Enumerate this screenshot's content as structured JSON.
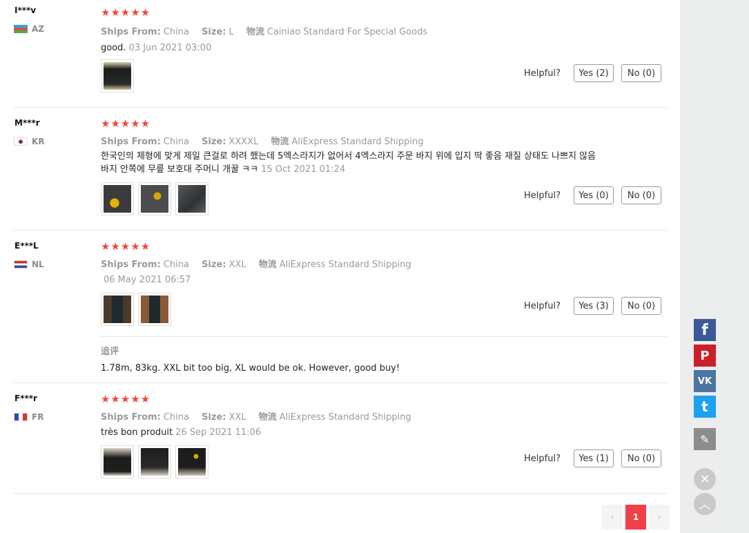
{
  "reviews": [
    {
      "user": "I***v",
      "country": "AZ",
      "stars": "★★★★★",
      "ships_label": "Ships From:",
      "ships_value": "China",
      "size_label": "Size:",
      "size_value": "L",
      "shipping_label": "物流",
      "shipping_value": "Cainiao Standard For Special Goods",
      "text": "good.",
      "date": "03 Jun 2021 03:00",
      "helpful_label": "Helpful?",
      "yes": "Yes (2)",
      "no": "No (0)"
    },
    {
      "user": "M***r",
      "country": "KR",
      "stars": "★★★★★",
      "ships_label": "Ships From:",
      "ships_value": "China",
      "size_label": "Size:",
      "size_value": "XXXXL",
      "shipping_label": "物流",
      "shipping_value": "AliExpress Standard Shipping",
      "text": "한국인의 체형에 맞게 제일 큰걸로 하려 했는데 5엑스라지가 없어서 4엑스라지 주문 바지 위에 입지 딱 좋음 재질 상태도 나쁘지 않음 바지 안쪽에 무릎 보호대 주머니 개꿀 ㅋㅋ",
      "date": "15 Oct 2021 01:24",
      "helpful_label": "Helpful?",
      "yes": "Yes (0)",
      "no": "No (0)"
    },
    {
      "user": "E***L",
      "country": "NL",
      "stars": "★★★★★",
      "ships_label": "Ships From:",
      "ships_value": "China",
      "size_label": "Size:",
      "size_value": "XXL",
      "shipping_label": "物流",
      "shipping_value": "AliExpress Standard Shipping",
      "text": "",
      "date": "06 May 2021 06:57",
      "helpful_label": "Helpful?",
      "yes": "Yes (3)",
      "no": "No (0)",
      "followup_title": "追评",
      "followup_text": "1.78m, 83kg. XXL bit too big, XL would be ok. However, good buy!"
    },
    {
      "user": "F***r",
      "country": "FR",
      "stars": "★★★★★",
      "ships_label": "Ships From:",
      "ships_value": "China",
      "size_label": "Size:",
      "size_value": "XXL",
      "shipping_label": "物流",
      "shipping_value": "AliExpress Standard Shipping",
      "text": "très bon produit",
      "date": "26 Sep 2021 11:06",
      "helpful_label": "Helpful?",
      "yes": "Yes (1)",
      "no": "No (0)"
    }
  ],
  "pagination": {
    "prev": "‹",
    "current": "1",
    "next": "›"
  },
  "share": {
    "facebook": "f",
    "pinterest": "P",
    "vk": "VK",
    "twitter": "t",
    "edit": "✎",
    "close": "✕",
    "top": "︿"
  },
  "colors": {
    "star": "#f2463a",
    "accent": "#f0404a",
    "facebook": "#3b5998",
    "pinterest": "#cb2027",
    "vk": "#4c75a3",
    "twitter": "#1da1f2",
    "edit": "#8c8c8c"
  }
}
